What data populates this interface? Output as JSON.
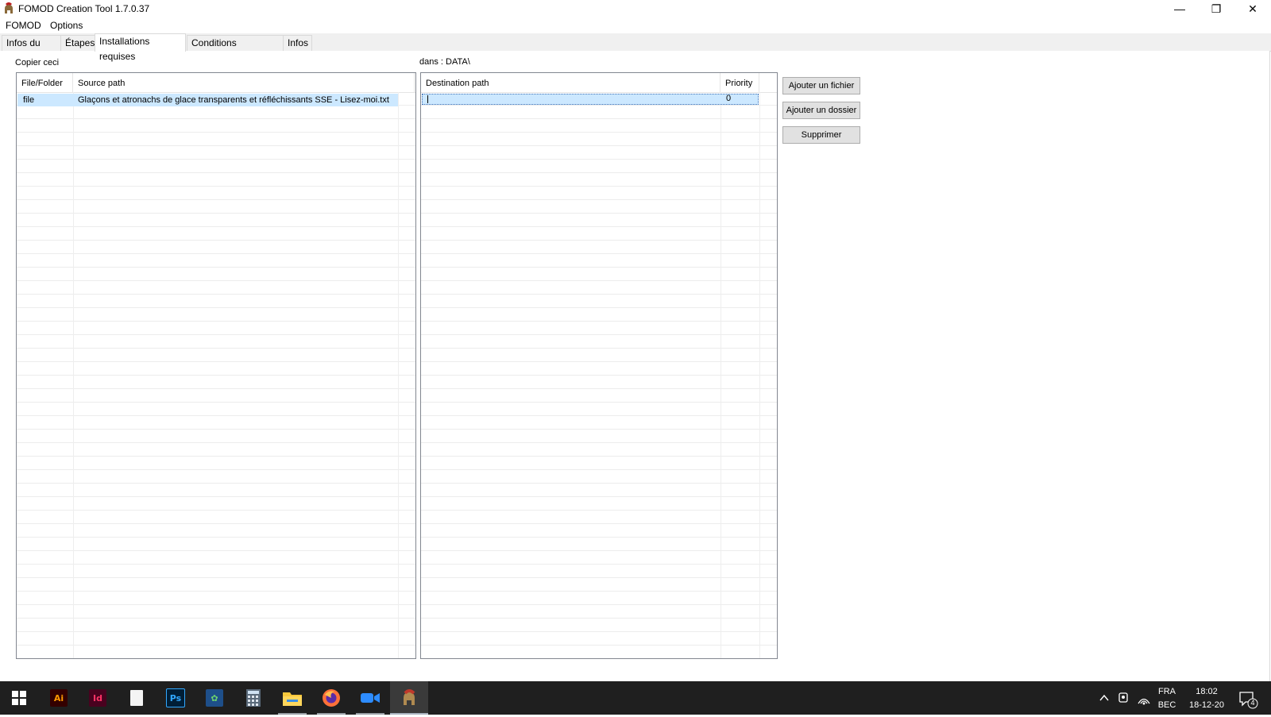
{
  "window": {
    "title": "FOMOD Creation Tool 1.7.0.37",
    "controls": {
      "minimize": "—",
      "maximize": "❐",
      "close": "✕"
    }
  },
  "menu": [
    "FOMOD",
    "Options"
  ],
  "tabs": [
    {
      "label": "Infos du mod",
      "active": false
    },
    {
      "label": "Étapes",
      "active": false
    },
    {
      "label": "Installations requises",
      "active": true
    },
    {
      "label": "Conditions d'installation",
      "active": false
    },
    {
      "label": "Infos",
      "active": false
    }
  ],
  "source_panel": {
    "label": "Copier ceci",
    "columns": [
      "File/Folder",
      "Source path"
    ],
    "rows": [
      {
        "type": "file",
        "path": "Glaçons et atronachs de glace transparents et réfléchissants SSE - Lisez-moi.txt"
      }
    ]
  },
  "dest_panel": {
    "label": "dans : DATA\\",
    "columns": [
      "Destination path",
      "Priority"
    ],
    "rows": [
      {
        "path": "",
        "priority": "0"
      }
    ]
  },
  "buttons": {
    "add_file": "Ajouter un fichier",
    "add_folder": "Ajouter un dossier",
    "delete": "Supprimer"
  },
  "taskbar": {
    "apps": [
      "windows-start",
      "illustrator",
      "indesign",
      "notepad",
      "photoshop",
      "sublime",
      "calculator",
      "file-explorer",
      "firefox",
      "zoom",
      "fomod-tool"
    ],
    "app_labels": {
      "illustrator": "Ai",
      "indesign": "Id",
      "photoshop": "Ps"
    },
    "lang": "FRA",
    "region": "BEC",
    "time": "18:02",
    "date": "18-12-20",
    "notifications": "4"
  },
  "colors": {
    "selection": "#cce8ff",
    "taskbar": "#1f1f1f",
    "button": "#e1e1e1"
  }
}
